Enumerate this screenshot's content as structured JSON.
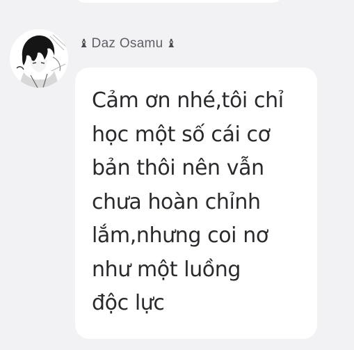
{
  "sender": {
    "name": "Daz Osamu",
    "badge_left_icon": "chess-bishop-icon",
    "badge_right_icon": "chess-bishop-icon",
    "badge_glyph": "♝"
  },
  "message": {
    "text": "Cảm ơn nhé,tôi chỉ\nhọc một số cái cơ\nbản thôi nên vẫn\nchưa hoàn chỉnh\nlắm,nhưng coi nơ\nnhư một luồng\nđộc lực"
  },
  "colors": {
    "background": "#f2f2f4",
    "bubble": "#ffffff",
    "text": "#2a2a2e",
    "sender_text": "#5e5e66"
  }
}
